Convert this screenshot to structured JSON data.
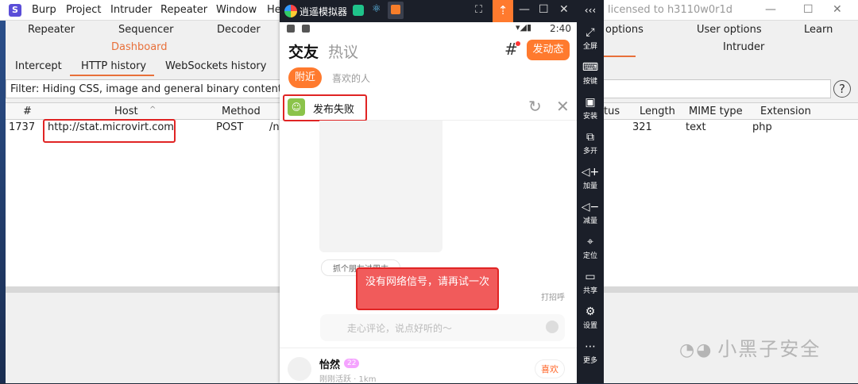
{
  "burp": {
    "menu": [
      "Burp",
      "Project",
      "Intruder",
      "Repeater",
      "Window",
      "He"
    ],
    "title": "licensed to h3110w0r1d",
    "tabs_row1": [
      "Repeater",
      "Sequencer",
      "Decoder"
    ],
    "tabs_row1_right": [
      "options",
      "User options",
      "Learn"
    ],
    "dashboard": "Dashboard",
    "intruder": "Intruder",
    "subtabs": [
      "Intercept",
      "HTTP history",
      "WebSockets history"
    ],
    "filter": "Filter: Hiding CSS, image and general binary content",
    "help": "?",
    "columns_left": [
      "#",
      "Host",
      "Method"
    ],
    "columns_right": [
      "tus",
      "Length",
      "MIME type",
      "Extension"
    ],
    "row": {
      "num": "1737",
      "host": "http://stat.microvirt.com",
      "method": "POST",
      "path": "/n",
      "length": "321",
      "mime": "text",
      "ext": "php"
    }
  },
  "emulator": {
    "app_name": "逍遥模拟器",
    "status_time": "2:40",
    "tabs": [
      "交友",
      "热议"
    ],
    "post_button": "发动态",
    "filters": [
      "附近",
      "喜欢的人"
    ],
    "post_status": "发布失败",
    "tag": "抓个朋友过周末",
    "toast": "没有网络信号，请再试一次",
    "greet": "打招呼",
    "comment_placeholder": "走心评论，说点好听的～",
    "user_name": "怡然",
    "user_badge": "22",
    "user_status": "刚刚活跃 · 1km",
    "like_button": "喜欢",
    "sidebar": [
      {
        "icon": "fullscreen-icon",
        "glyph": "⤢",
        "label": "全屏"
      },
      {
        "icon": "keyboard-icon",
        "glyph": "⌨",
        "label": "按键"
      },
      {
        "icon": "apk-icon",
        "glyph": "▣",
        "label": "安装"
      },
      {
        "icon": "multi-open-icon",
        "glyph": "⧉",
        "label": "多开"
      },
      {
        "icon": "volume-up-icon",
        "glyph": "◁+",
        "label": "加量"
      },
      {
        "icon": "volume-down-icon",
        "glyph": "◁−",
        "label": "减量"
      },
      {
        "icon": "location-icon",
        "glyph": "⌖",
        "label": "定位"
      },
      {
        "icon": "folder-icon",
        "glyph": "▭",
        "label": "共享"
      },
      {
        "icon": "settings-icon",
        "glyph": "⚙",
        "label": "设置"
      },
      {
        "icon": "more-icon",
        "glyph": "⋯",
        "label": "更多"
      }
    ]
  },
  "watermark": "小黑子安全",
  "colors": {
    "accent": "#ff7a2e",
    "highlight": "#e02424",
    "burp_orange": "#e8703a"
  }
}
